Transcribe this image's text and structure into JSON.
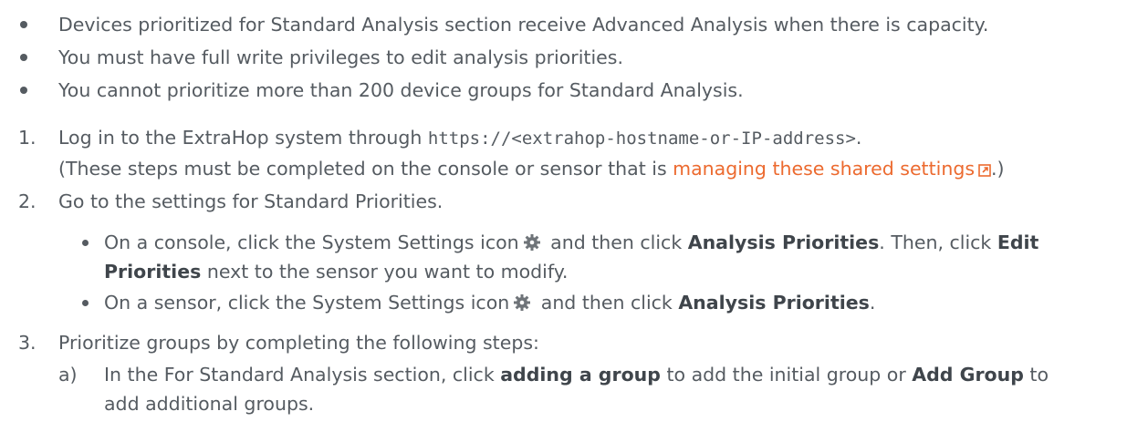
{
  "bullets": [
    "Devices prioritized for Standard Analysis section receive Advanced Analysis when there is capacity.",
    "You must have full write privileges to edit analysis priorities.",
    "You cannot prioritize more than 200 device groups for Standard Analysis."
  ],
  "step1": {
    "number": "1.",
    "prefix": "Log in to the ExtraHop system through ",
    "url": "https://<extrahop-hostname-or-IP-address>",
    "suffix": ".",
    "note_prefix": "(These steps must be completed on the console or sensor that is ",
    "note_link": "managing these shared settings",
    "note_suffix": ".)"
  },
  "step2": {
    "number": "2.",
    "text": "Go to the settings for Standard Priorities.",
    "sub1": {
      "prefix": "On a console, click the System Settings icon",
      "mid": " and then click ",
      "bold1": "Analysis Priorities",
      "mid2": ". Then, click ",
      "bold2a": "Edit",
      "bold2b": "Priorities",
      "suffix": " next to the sensor you want to modify."
    },
    "sub2": {
      "prefix": "On a sensor, click the System Settings icon",
      "mid": " and then click ",
      "bold": "Analysis Priorities",
      "suffix": "."
    }
  },
  "step3": {
    "number": "3.",
    "text": "Prioritize groups by completing the following steps:",
    "sub_a": {
      "letter": "a)",
      "prefix": "In the For Standard Analysis section, click ",
      "bold1": "adding a group",
      "mid": " to add the initial group or ",
      "bold2": "Add Group",
      "suffix": " to",
      "line2": "add additional groups."
    }
  }
}
